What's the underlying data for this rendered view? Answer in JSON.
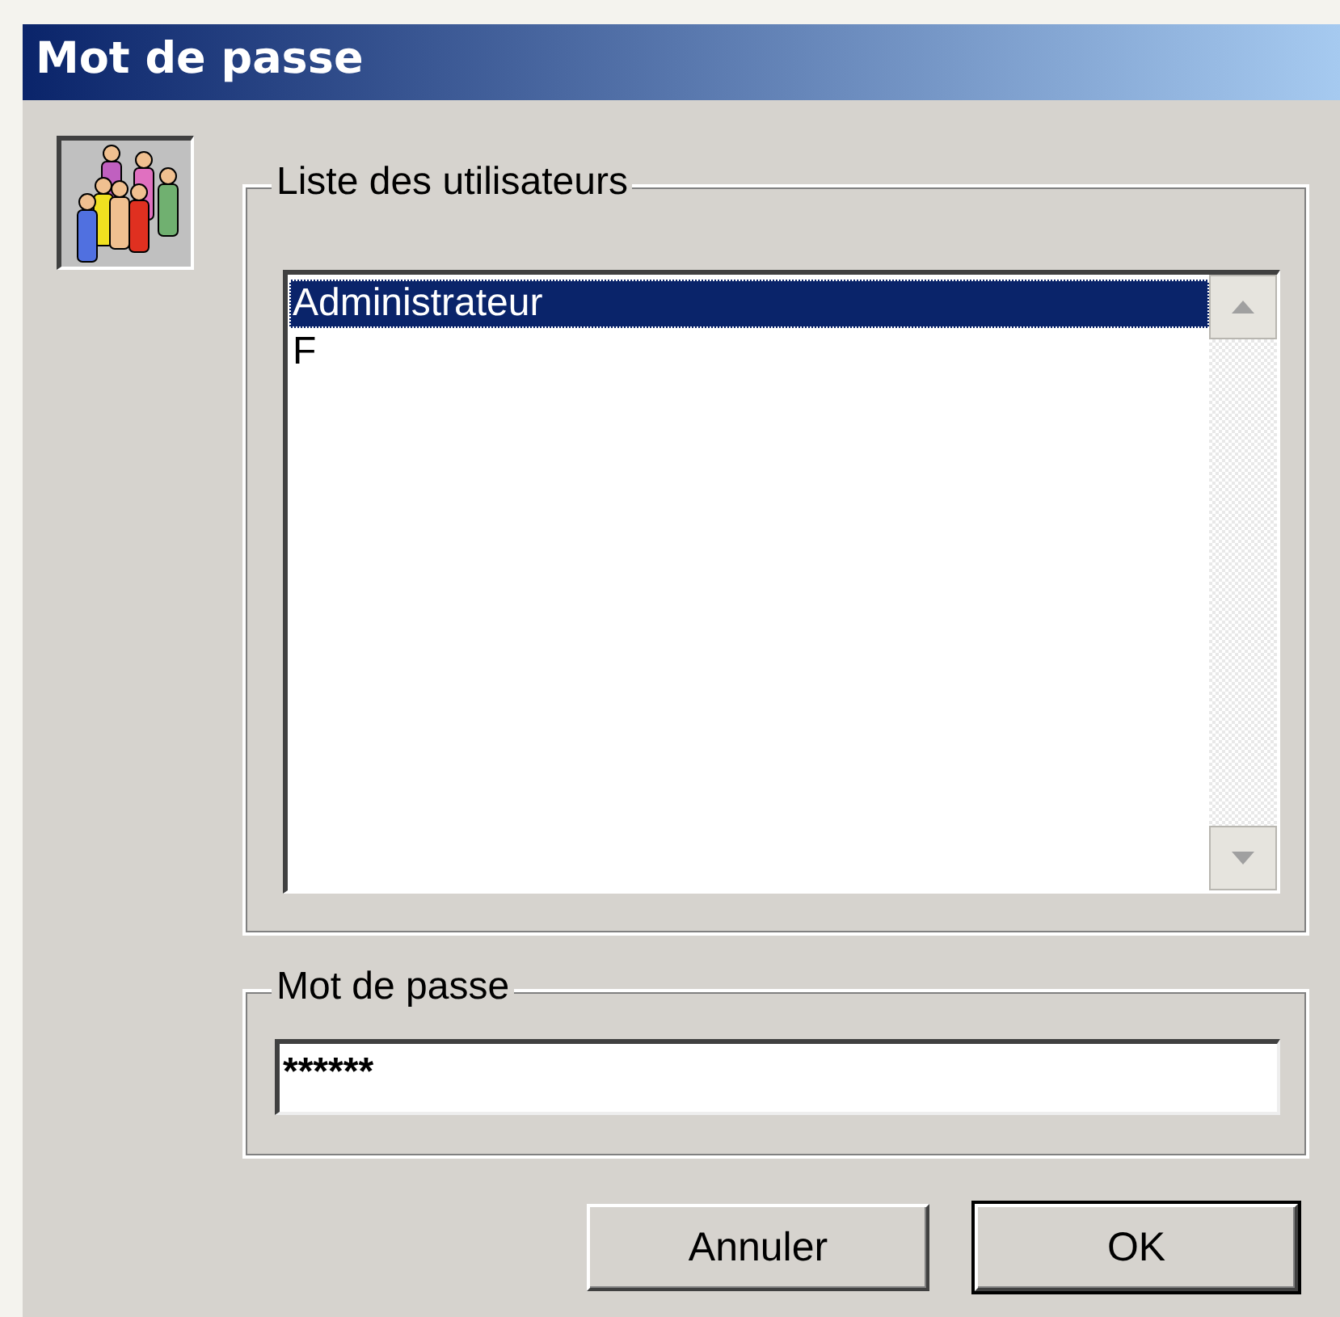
{
  "window": {
    "title": "Mot de passe"
  },
  "users": {
    "label": "Liste des utilisateurs",
    "items": [
      {
        "name": "Administrateur",
        "selected": true
      },
      {
        "name": "F",
        "selected": false
      }
    ]
  },
  "password": {
    "label": "Mot de passe",
    "value": "******"
  },
  "buttons": [
    {
      "label": "Annuler",
      "default": false
    },
    {
      "label": "OK",
      "default": true
    }
  ]
}
